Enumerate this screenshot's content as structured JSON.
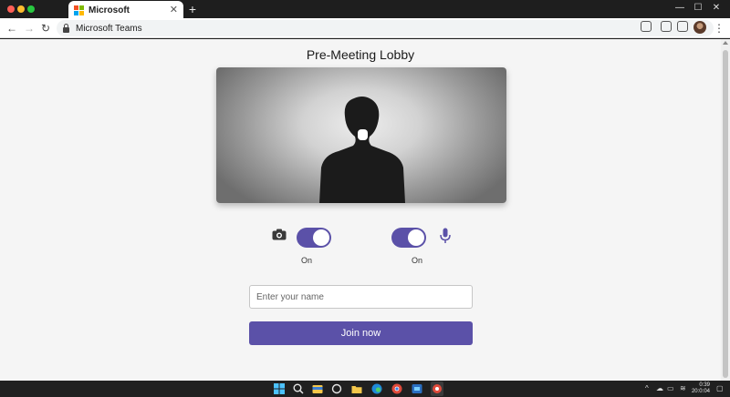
{
  "browser": {
    "tab_title": "Microsoft",
    "address": "Microsoft Teams"
  },
  "lobby": {
    "title": "Pre-Meeting Lobby",
    "camera": {
      "state_label": "On",
      "enabled": true
    },
    "microphone": {
      "state_label": "On",
      "enabled": true
    },
    "name_input": {
      "placeholder": "Enter your name",
      "value": ""
    },
    "join_label": "Join now"
  },
  "taskbar": {
    "clock_time": "0:39",
    "clock_date": "20:0:04"
  },
  "colors": {
    "accent": "#5b51a8",
    "page_bg": "#f5f5f5",
    "titlebar_bg": "#1e1e1e",
    "taskbar_bg": "#202020"
  },
  "icons": {
    "window": [
      "red-dot-icon",
      "yellow-dot-icon",
      "green-dot-icon",
      "microsoft-logo-icon",
      "close-icon",
      "plus-icon",
      "minimize-icon",
      "maximize-icon",
      "window-close-icon"
    ],
    "navigation": [
      "back-arrow-icon",
      "forward-arrow-icon",
      "reload-icon",
      "lock-icon",
      "share-icon",
      "extension-icon",
      "screenshot-icon",
      "profile-avatar-icon",
      "kebab-menu-icon"
    ],
    "lobby": [
      "camera-icon",
      "microphone-icon"
    ],
    "taskbar": [
      "windows-start-icon",
      "search-icon",
      "file-explorer-icon",
      "cortana-icon",
      "folder-icon",
      "edge-icon",
      "chrome-icon",
      "store-icon",
      "app-icon",
      "chevron-up-icon",
      "cloud-icon",
      "battery-icon",
      "wifi-icon",
      "notification-icon"
    ]
  }
}
